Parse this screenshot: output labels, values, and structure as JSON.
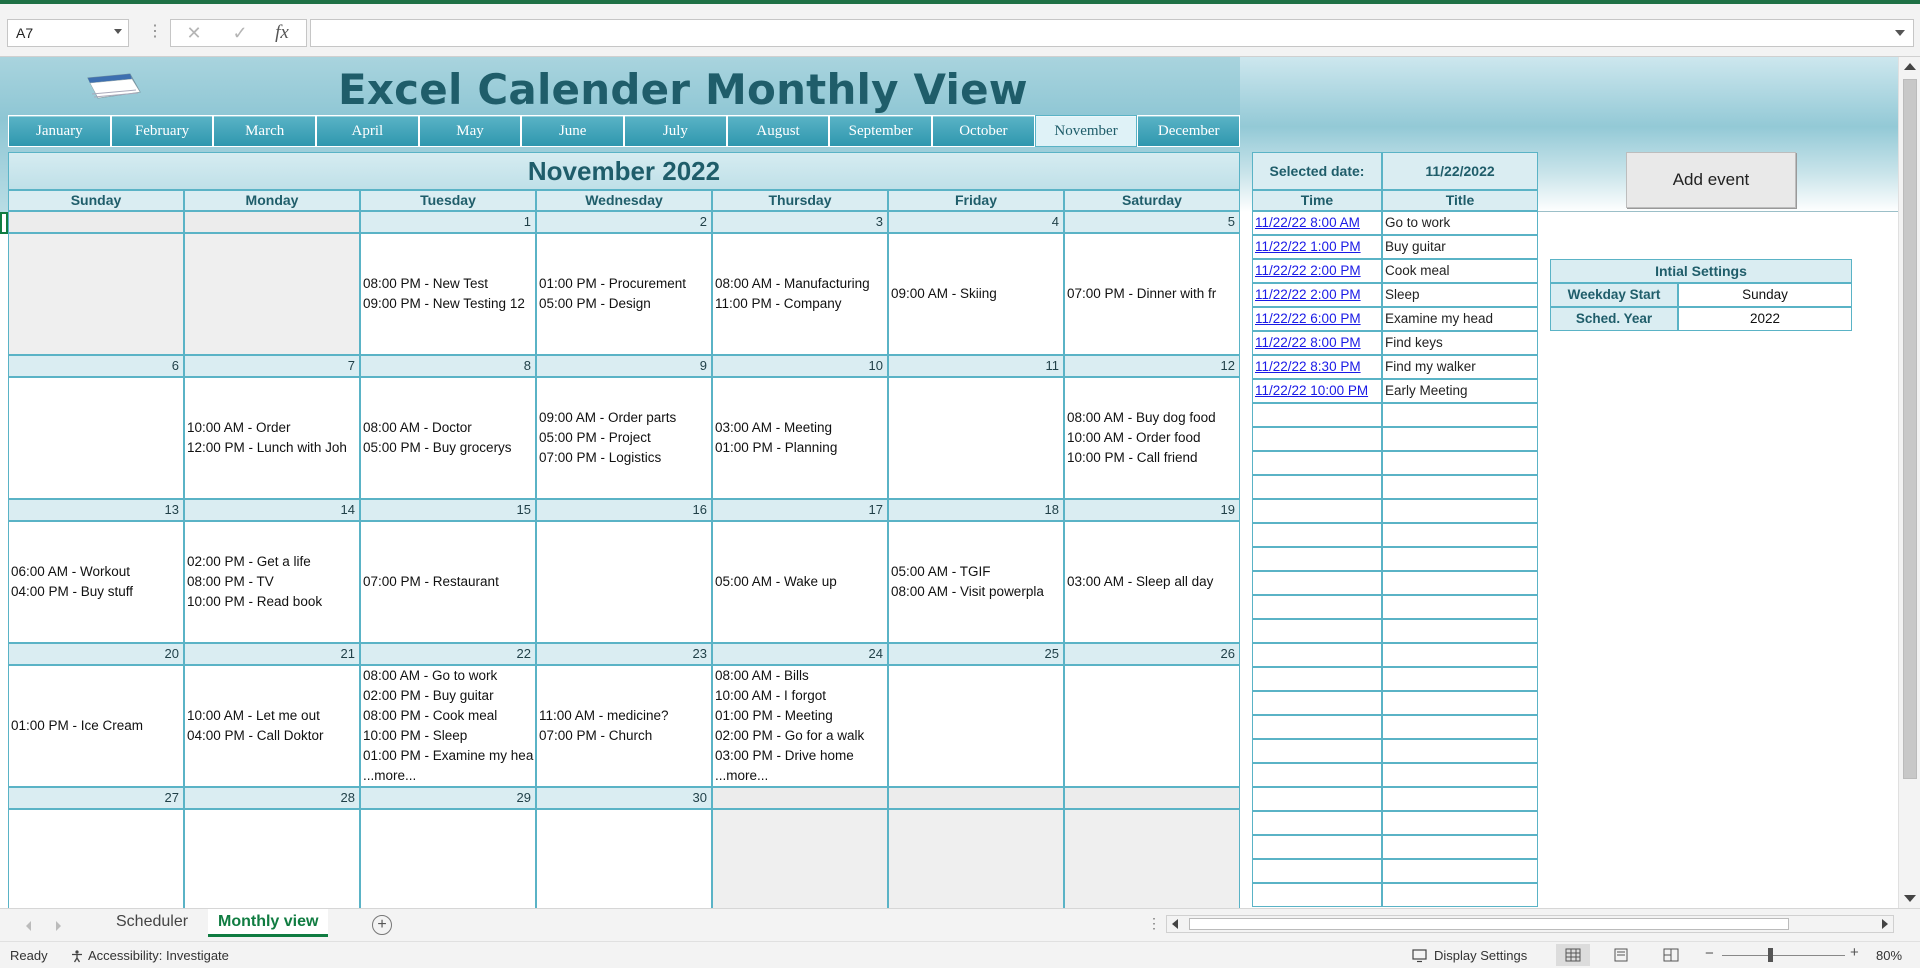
{
  "formula_bar": {
    "name_box": "A7",
    "cancel_glyph": "✕",
    "enter_glyph": "✓",
    "fx_label": "fx",
    "formula": ""
  },
  "header": {
    "title": "Excel Calender Monthly View",
    "months": [
      "January",
      "February",
      "March",
      "April",
      "May",
      "June",
      "July",
      "August",
      "September",
      "October",
      "November",
      "December"
    ],
    "active_month": "November"
  },
  "calendar": {
    "title": "November 2022",
    "weekdays": [
      "Sunday",
      "Monday",
      "Tuesday",
      "Wednesday",
      "Thursday",
      "Friday",
      "Saturday"
    ],
    "weeks": [
      [
        {
          "day": "",
          "events": [],
          "out": true
        },
        {
          "day": "",
          "events": [],
          "out": true
        },
        {
          "day": "1",
          "events": [
            "08:00 PM - New Test",
            "09:00 PM - New Testing 12"
          ]
        },
        {
          "day": "2",
          "events": [
            "01:00 PM - Procurement",
            "05:00 PM - Design"
          ]
        },
        {
          "day": "3",
          "events": [
            "08:00 AM - Manufacturing",
            "11:00 PM - Company"
          ]
        },
        {
          "day": "4",
          "events": [
            "09:00 AM - Skiing"
          ]
        },
        {
          "day": "5",
          "events": [
            "07:00 PM - Dinner with fr"
          ]
        }
      ],
      [
        {
          "day": "6",
          "events": []
        },
        {
          "day": "7",
          "events": [
            "10:00 AM - Order",
            "12:00 PM - Lunch with Joh"
          ]
        },
        {
          "day": "8",
          "events": [
            "08:00 AM - Doctor",
            "05:00 PM - Buy grocerys"
          ]
        },
        {
          "day": "9",
          "events": [
            "09:00 AM - Order parts",
            "05:00 PM - Project",
            "07:00 PM - Logistics"
          ]
        },
        {
          "day": "10",
          "events": [
            "03:00 AM - Meeting",
            "01:00 PM - Planning"
          ]
        },
        {
          "day": "11",
          "events": []
        },
        {
          "day": "12",
          "events": [
            "08:00 AM - Buy dog food",
            "10:00 AM - Order food",
            "10:00 PM - Call friend"
          ]
        }
      ],
      [
        {
          "day": "13",
          "events": [
            "06:00 AM - Workout",
            "04:00 PM - Buy stuff"
          ]
        },
        {
          "day": "14",
          "events": [
            "02:00 PM - Get a life",
            "08:00 PM - TV",
            "10:00 PM - Read book"
          ]
        },
        {
          "day": "15",
          "events": [
            "07:00 PM - Restaurant"
          ]
        },
        {
          "day": "16",
          "events": []
        },
        {
          "day": "17",
          "events": [
            "05:00 AM - Wake up"
          ]
        },
        {
          "day": "18",
          "events": [
            "05:00 AM - TGIF",
            "08:00 AM - Visit powerpla"
          ]
        },
        {
          "day": "19",
          "events": [
            "03:00 AM - Sleep all day"
          ]
        }
      ],
      [
        {
          "day": "20",
          "events": [
            "01:00 PM - Ice Cream"
          ]
        },
        {
          "day": "21",
          "events": [
            "10:00 AM - Let me out",
            "04:00 PM - Call Doktor"
          ]
        },
        {
          "day": "22",
          "events": [
            "08:00 AM - Go to work",
            "02:00 PM - Buy guitar",
            "08:00 PM - Cook meal",
            "10:00 PM - Sleep",
            "01:00 PM - Examine my hea",
            "...more..."
          ]
        },
        {
          "day": "23",
          "events": [
            "11:00 AM - medicine?",
            "07:00 PM - Church"
          ]
        },
        {
          "day": "24",
          "events": [
            "08:00 AM - Bills",
            "10:00 AM - I forgot",
            "01:00 PM - Meeting",
            "02:00 PM - Go for a walk",
            "03:00 PM - Drive home",
            "...more..."
          ]
        },
        {
          "day": "25",
          "events": []
        },
        {
          "day": "26",
          "events": []
        }
      ],
      [
        {
          "day": "27",
          "events": []
        },
        {
          "day": "28",
          "events": []
        },
        {
          "day": "29",
          "events": []
        },
        {
          "day": "30",
          "events": []
        },
        {
          "day": "",
          "events": [],
          "out": true
        },
        {
          "day": "",
          "events": [],
          "out": true
        },
        {
          "day": "",
          "events": [],
          "out": true
        }
      ]
    ]
  },
  "selected": {
    "label": "Selected date:",
    "value": "11/22/2022",
    "time_header": "Time",
    "title_header": "Title",
    "events": [
      {
        "time": "11/22/22 8:00 AM",
        "title": "Go to work"
      },
      {
        "time": "11/22/22 1:00 PM",
        "title": "Buy guitar"
      },
      {
        "time": "11/22/22 2:00 PM",
        "title": "Cook meal"
      },
      {
        "time": "11/22/22 2:00 PM",
        "title": "Sleep"
      },
      {
        "time": "11/22/22 6:00 PM",
        "title": "Examine my head"
      },
      {
        "time": "11/22/22 8:00 PM",
        "title": "Find keys"
      },
      {
        "time": "11/22/22 8:30 PM",
        "title": "Find my walker"
      },
      {
        "time": "11/22/22 10:00 PM",
        "title": "Early Meeting"
      }
    ],
    "empty_rows": 21
  },
  "add_event_label": "Add event",
  "settings": {
    "title": "Intial Settings",
    "rows": [
      {
        "label": "Weekday Start",
        "value": "Sunday"
      },
      {
        "label": "Sched. Year",
        "value": "2022"
      }
    ]
  },
  "sheet_tabs": {
    "tabs": [
      "Scheduler",
      "Monthly view"
    ],
    "active": "Monthly view",
    "add_glyph": "+"
  },
  "status": {
    "ready": "Ready",
    "accessibility": "Accessibility: Investigate",
    "display_settings": "Display Settings",
    "zoom": "80%"
  },
  "colors": {
    "accent": "#107c41",
    "header_teal": "#1f5d6a",
    "tab_blue": "#2f97ae",
    "grid_line": "#5ab3c6",
    "link": "#1a1ae6"
  }
}
